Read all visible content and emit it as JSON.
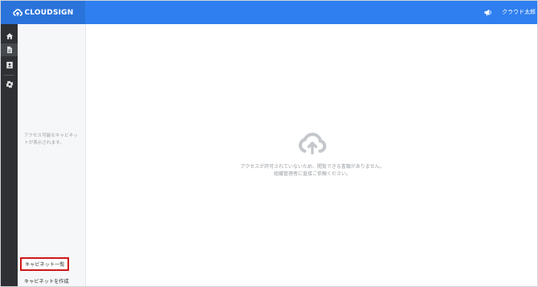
{
  "header": {
    "brand": "CLOUDSIGN",
    "user_name": "クラウド太郎",
    "announcement_icon": "megaphone-icon"
  },
  "rail": {
    "items": [
      {
        "icon": "home-icon",
        "active": false
      },
      {
        "icon": "document-icon",
        "active": true
      },
      {
        "icon": "contact-book-icon",
        "active": false
      },
      {
        "icon": "gear-icon",
        "active": false
      }
    ]
  },
  "sidebar": {
    "empty_message": "アクセス可能なキャビネットが表示されます。",
    "cabinet_list_label": "キャビネット一覧",
    "create_cabinet_label": "キャビネットを作成"
  },
  "main": {
    "empty_icon": "cloud-icon",
    "message_line1": "アクセスが許可されていないため、閲覧できる書類がありません。",
    "message_line2": "組織管理者に直接ご依頼ください。"
  },
  "colors": {
    "header": "#2f7ff0",
    "brand_bg": "#2a73db",
    "rail": "#2e3033",
    "highlight": "#d0191b"
  }
}
